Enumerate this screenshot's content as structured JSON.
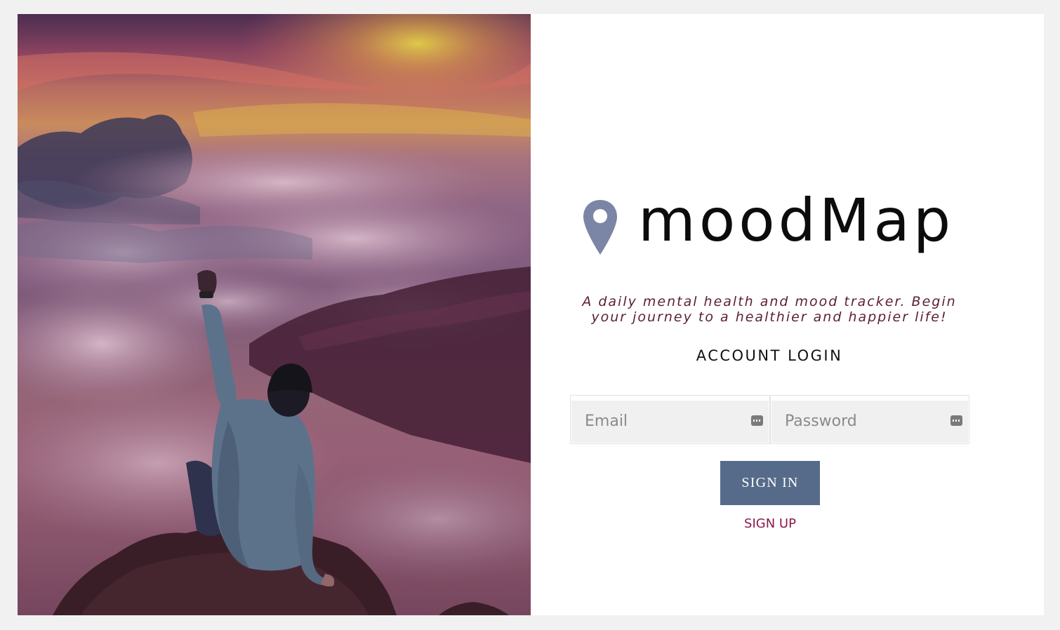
{
  "brand": {
    "name": "moodMap",
    "icon": "map-pin-icon",
    "pin_color": "#7b86a6"
  },
  "tagline": "A daily mental health and mood tracker. Begin your journey to a healthier and happier life!",
  "login": {
    "title": "ACCOUNT LOGIN",
    "email_placeholder": "Email",
    "password_placeholder": "Password",
    "signin_label": "SIGN IN",
    "signup_label": "SIGN UP"
  },
  "colors": {
    "button": "#566a89",
    "signup_link": "#8c1a4d",
    "tagline": "#5b1f33"
  }
}
